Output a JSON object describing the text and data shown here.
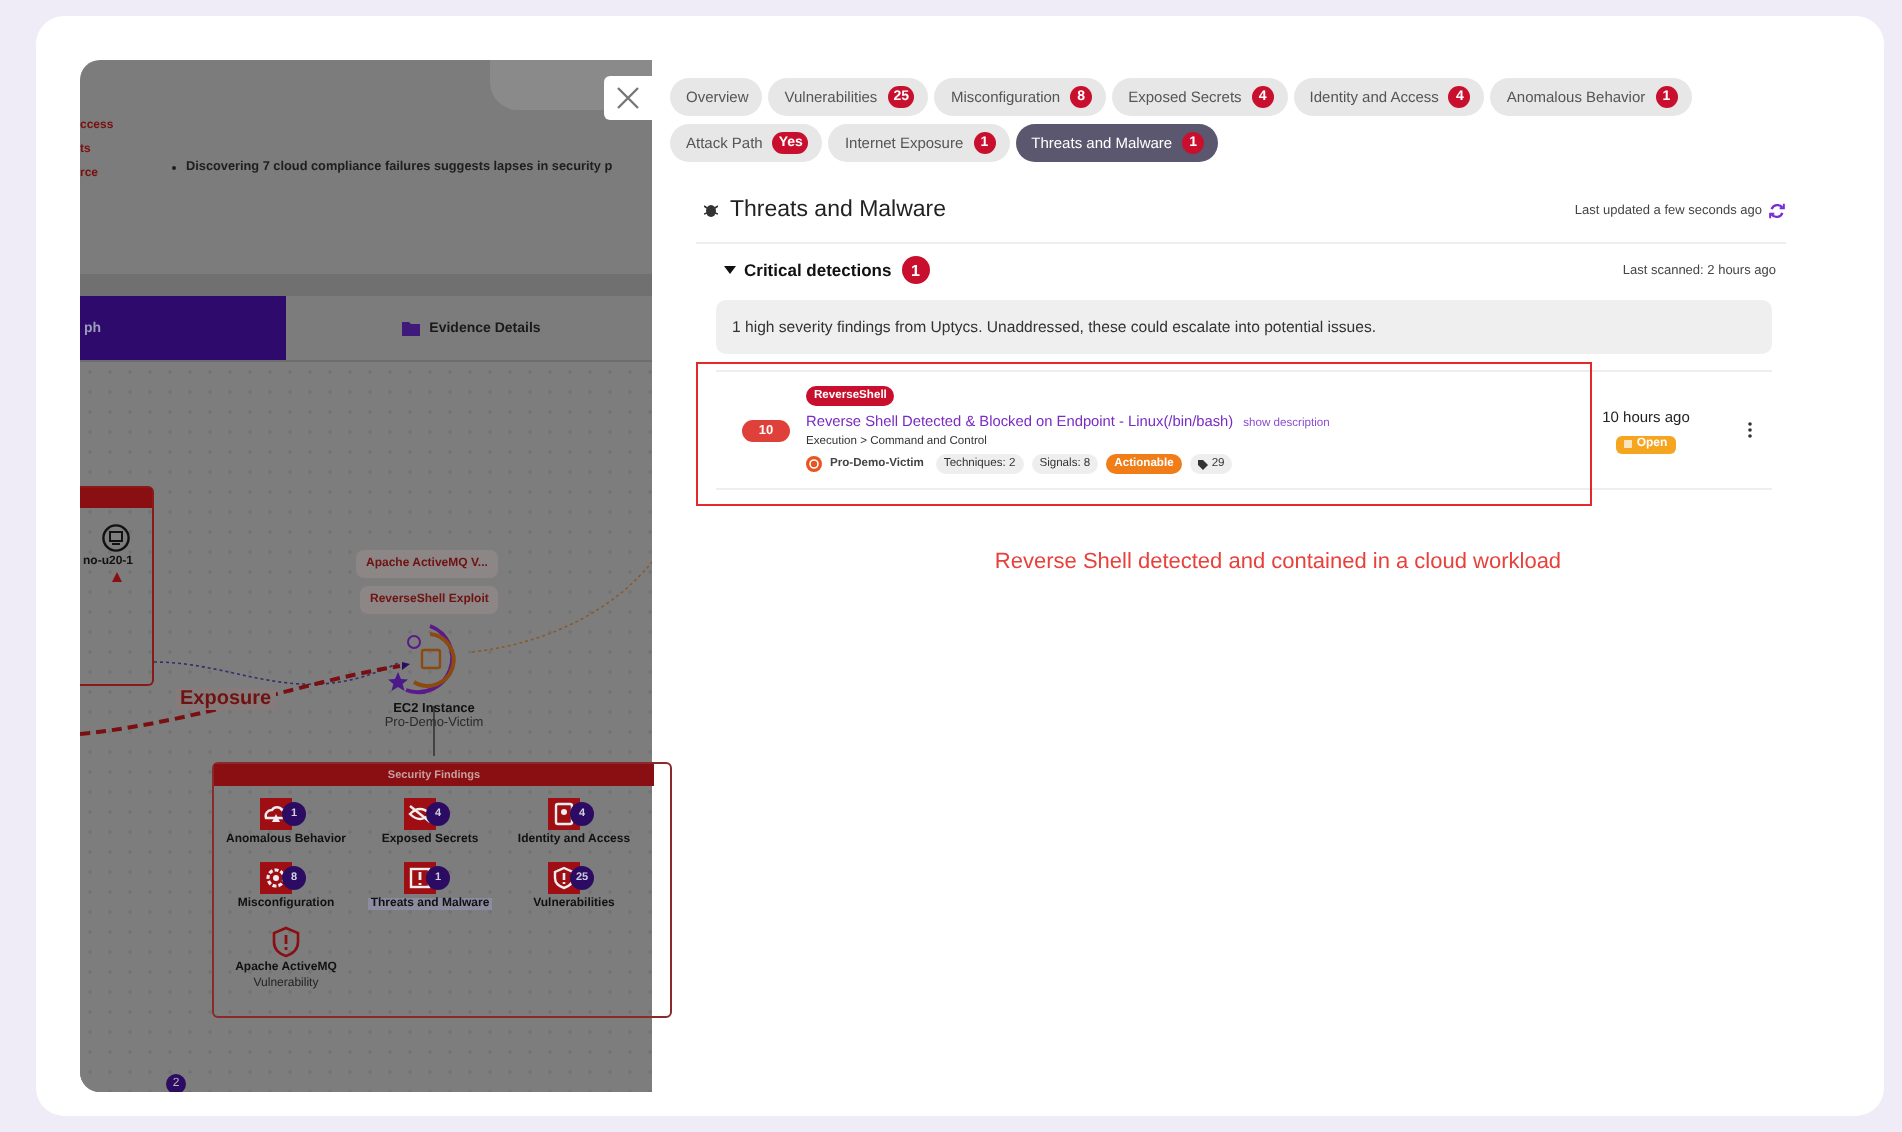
{
  "background_app": {
    "sidebar_links": [
      "ccess",
      "ts",
      "rce"
    ],
    "bullets": [
      "Discovering 7 cloud compliance failures suggests lapses in security p"
    ],
    "tabs": [
      {
        "label": "ph",
        "selected": true
      },
      {
        "label": "Evidence Details",
        "selected": false
      }
    ],
    "graph": {
      "host_node": {
        "label": "no-u20-1"
      },
      "edge_labels": [
        "Apache ActiveMQ V...",
        "ReverseShell Exploit"
      ],
      "exposure_label": "Exposure",
      "instance": {
        "type": "EC2 Instance",
        "name": "Pro-Demo-Victim"
      },
      "findings": {
        "title": "Security Findings",
        "items": [
          {
            "kind": "anomalous",
            "label": "Anomalous Behavior",
            "count": "1",
            "selected": false
          },
          {
            "kind": "secrets",
            "label": "Exposed Secrets",
            "count": "4",
            "selected": false
          },
          {
            "kind": "identity",
            "label": "Identity and Access",
            "count": "4",
            "selected": false
          },
          {
            "kind": "misconfig",
            "label": "Misconfiguration",
            "count": "8",
            "selected": false
          },
          {
            "kind": "threats",
            "label": "Threats and Malware",
            "count": "1",
            "selected": true
          },
          {
            "kind": "vulns",
            "label": "Vulnerabilities",
            "count": "25",
            "selected": false
          },
          {
            "kind": "vulnerability",
            "label": "Apache ActiveMQ",
            "sublabel": "Vulnerability",
            "selected": false
          }
        ]
      },
      "bottom_badge": "2"
    }
  },
  "tabs": [
    {
      "label": "Overview",
      "selected": false
    },
    {
      "label": "Vulnerabilities",
      "count": "25",
      "selected": false
    },
    {
      "label": "Misconfiguration",
      "count": "8",
      "selected": false
    },
    {
      "label": "Exposed Secrets",
      "count": "4",
      "selected": false
    },
    {
      "label": "Identity and Access",
      "count": "4",
      "selected": false
    },
    {
      "label": "Anomalous Behavior",
      "count": "1",
      "selected": false
    },
    {
      "label": "Attack Path",
      "count": "Yes",
      "selected": false
    },
    {
      "label": "Internet Exposure",
      "count": "1",
      "selected": false
    },
    {
      "label": "Threats and Malware",
      "count": "1",
      "selected": true
    }
  ],
  "section": {
    "title": "Threats and Malware",
    "last_updated": "Last updated a few seconds ago"
  },
  "group": {
    "title": "Critical detections",
    "count": "1",
    "expanded": true,
    "last_scanned": "Last scanned: 2 hours ago"
  },
  "summary": "1 high severity findings from Uptycs. Unaddressed, these could escalate into potential issues.",
  "detections": [
    {
      "score": "10",
      "tag": "ReverseShell",
      "title": "Reverse Shell Detected & Blocked on Endpoint - Linux(/bin/bash)",
      "link": "show description",
      "path": "Execution > Command and Control",
      "host": "Pro-Demo-Victim",
      "chips": [
        {
          "kind": "plain",
          "label": "Techniques: 2"
        },
        {
          "kind": "plain",
          "label": "Signals: 8"
        },
        {
          "kind": "warning",
          "label": "Actionable"
        },
        {
          "kind": "tag",
          "label": "29"
        }
      ],
      "time": "10 hours ago",
      "status": "Open",
      "highlighted": true
    }
  ],
  "annotation": "Reverse Shell detected and contained in a cloud workload"
}
